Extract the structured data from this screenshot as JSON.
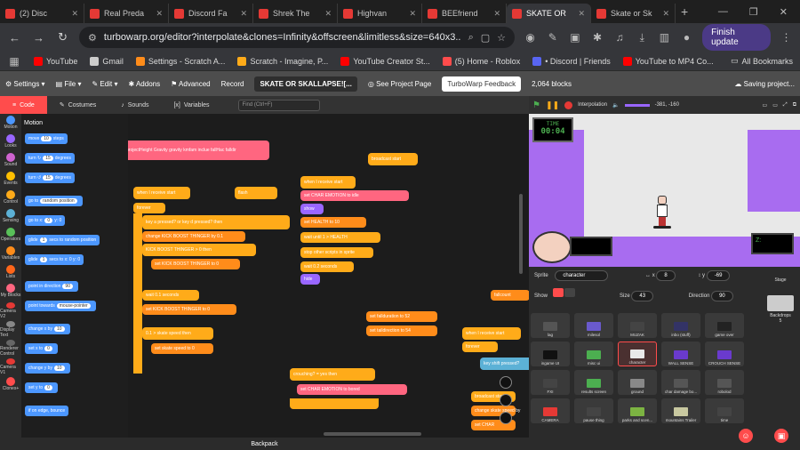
{
  "browser": {
    "tabs": [
      {
        "label": "(2) Disc",
        "active": false
      },
      {
        "label": "Real Preda",
        "active": false
      },
      {
        "label": "Discord Fa",
        "active": false
      },
      {
        "label": "Shrek The",
        "active": false
      },
      {
        "label": "Highvan",
        "active": false
      },
      {
        "label": "BEEfriend",
        "active": false
      },
      {
        "label": "SKATE OR",
        "active": true
      },
      {
        "label": "Skate or Sk",
        "active": false
      }
    ],
    "url": "turbowarp.org/editor?interpolate&clones=Infinity&offscreen&limitless&size=640x3...",
    "finish_update": "Finish update",
    "bookmarks": [
      {
        "label": "YouTube",
        "color": "#ff0000"
      },
      {
        "label": "Gmail",
        "color": "#cccccc"
      },
      {
        "label": "Settings - Scratch A...",
        "color": "#ff8c1a"
      },
      {
        "label": "Scratch - Imagine, P...",
        "color": "#ffab19"
      },
      {
        "label": "YouTube Creator St...",
        "color": "#ff0000"
      },
      {
        "label": "(5) Home - Roblox",
        "color": "#ff4c4c"
      },
      {
        "label": "• Discord | Friends",
        "color": "#5865f2"
      },
      {
        "label": "YouTube to MP4 Co...",
        "color": "#ff0000"
      }
    ],
    "all_bookmarks": "All Bookmarks"
  },
  "menu": {
    "settings": "Settings",
    "file": "File",
    "edit": "Edit",
    "addons": "Addons",
    "advanced": "Advanced",
    "record": "Record",
    "project_title": "SKATE OR SKALLAPSE![...",
    "see_project": "See Project Page",
    "feedback": "TurboWarp Feedback",
    "blocks": "2,064 blocks",
    "saving": "Saving project..."
  },
  "editor_tabs": {
    "code": "Code",
    "costumes": "Costumes",
    "sounds": "Sounds",
    "variables": "Variables",
    "find": "Find (Ctrl+F)"
  },
  "categories": [
    {
      "label": "Motion",
      "color": "#4c97ff"
    },
    {
      "label": "Looks",
      "color": "#9966ff"
    },
    {
      "label": "Sound",
      "color": "#cf63cf"
    },
    {
      "label": "Events",
      "color": "#ffbf00"
    },
    {
      "label": "Control",
      "color": "#ffab19"
    },
    {
      "label": "Sensing",
      "color": "#5cb1d6"
    },
    {
      "label": "Operators",
      "color": "#59c059"
    },
    {
      "label": "Variables",
      "color": "#ff8c1a"
    },
    {
      "label": "Lists",
      "color": "#ff661a"
    },
    {
      "label": "My Blocks",
      "color": "#ff6680"
    },
    {
      "label": "Camera V2",
      "color": "#e53935"
    },
    {
      "label": "Display Text",
      "color": "#888888"
    },
    {
      "label": "Renderer Control",
      "color": "#666666"
    },
    {
      "label": "Camera V1",
      "color": "#e53935"
    },
    {
      "label": "Clones+",
      "color": "#ff4c4c"
    }
  ],
  "palette": {
    "title": "Motion",
    "blocks": [
      {
        "a": "move",
        "v": "10",
        "b": "steps"
      },
      {
        "a": "turn ↻",
        "v": "15",
        "b": "degrees"
      },
      {
        "a": "turn ↺",
        "v": "15",
        "b": "degrees"
      },
      {
        "a": "go to",
        "v": "random position",
        "b": ""
      },
      {
        "a": "go to x:",
        "v": "0",
        "b": "y: 0"
      },
      {
        "a": "glide",
        "v": "1",
        "b": "secs to random position"
      },
      {
        "a": "glide",
        "v": "1",
        "b": "secs to x: 0 y: 0"
      },
      {
        "a": "point in direction",
        "v": "90",
        "b": ""
      },
      {
        "a": "point towards",
        "v": "mouse-pointer",
        "b": ""
      },
      {
        "a": "change x by",
        "v": "10",
        "b": ""
      },
      {
        "a": "set x to",
        "v": "0",
        "b": ""
      },
      {
        "a": "change y by",
        "v": "10",
        "b": ""
      },
      {
        "a": "set y to",
        "v": "0",
        "b": ""
      },
      {
        "a": "if on edge, bounce",
        "v": "",
        "b": ""
      }
    ]
  },
  "workspace": {
    "define_block": "projectHeight  Gravity  gravity  kmfam  inclue  fallHac  falldir",
    "when_receive_a": "when I receive  start",
    "forever": "forever",
    "key": "key  a  pressed?  or  key  d  pressed?  then",
    "change_kick": "change  KICK BOOST THINGER  by  0.1",
    "kick_then": "KICK BOOST THINGER  >  0  then",
    "set_kick": "set  KICK BOOST THINGER  to  0",
    "wait": "wait  0.1  seconds",
    "set_kick2": "set  KICK BOOST THINGER  to  0",
    "skate_speed": "0.1  >  skate speed  then",
    "set_speed": "set  skate speed  to  0",
    "flash": "flash",
    "when_receive_b": "when I receive  start",
    "set_emotion": "set  CHAR EMOTION  to  idle",
    "show": "show",
    "set_health": "set  HEALTH  to  10",
    "wait_until": "wait until  1  >  HEALTH",
    "stop": "stop  other scripts in sprite",
    "wait2": "wait  0.2  seconds",
    "hide": "hide",
    "broadcast": "broadcast  start",
    "fallduration": "set  fallduration  to  52",
    "taildirection": "set  taildirection  to  54",
    "crouching": "crouching?  =  yes  then",
    "set_emotion2": "set  CHAR EMOTION  to  bored",
    "when_receive_c": "when I receive  start",
    "forever2": "forever",
    "key_shift": "key  shift  pressed?",
    "broadcast2": "broadcast  start",
    "change_speed": "change  skate speed  by",
    "set_char": "set  CHAR",
    "fallcounter": "fallcount"
  },
  "backpack": "Backpack",
  "stage_bar": {
    "interpolation": "Interpolation",
    "coords": "-381, -160"
  },
  "stage": {
    "timer_label": "TIME",
    "timer_value": "00:04",
    "z_label": "Z:"
  },
  "sprite_info": {
    "sprite_label": "Sprite",
    "sprite_name": "character",
    "x_label": "↔ x",
    "x": "8",
    "y_label": "↕ y",
    "y": "-69",
    "show_label": "Show",
    "size_label": "Size",
    "size": "43",
    "direction_label": "Direction",
    "direction": "90"
  },
  "sprites": [
    {
      "label": "lag",
      "color": "#555555"
    },
    {
      "label": "milesol",
      "color": "#6a5acd"
    },
    {
      "label": "MUZAK",
      "color": "#444444"
    },
    {
      "label": "inbo (stuff)",
      "color": "#333366"
    },
    {
      "label": "game over",
      "color": "#222222"
    },
    {
      "label": "ingame UI",
      "color": "#111111"
    },
    {
      "label": "misc ui",
      "color": "#4caf50"
    },
    {
      "label": "character",
      "color": "#e8e8e8",
      "selected": true
    },
    {
      "label": "WALL SENSE",
      "color": "#6a3acd"
    },
    {
      "label": "CROUCH SENSE",
      "color": "#6a3acd"
    },
    {
      "label": "FXI",
      "color": "#444444"
    },
    {
      "label": "results screen",
      "color": "#4caf50"
    },
    {
      "label": "ground",
      "color": "#888888"
    },
    {
      "label": "char damage bo...",
      "color": "#555555"
    },
    {
      "label": "robolod",
      "color": "#555555"
    },
    {
      "label": "CAMERA",
      "color": "#e53935"
    },
    {
      "label": "pause thing",
      "color": "#444444"
    },
    {
      "label": "parks and scen...",
      "color": "#7cb342"
    },
    {
      "label": "mountains Trailer",
      "color": "#c8c8a0"
    },
    {
      "label": "time",
      "color": "#444444"
    }
  ],
  "stage_panel": {
    "label": "Stage",
    "backdrops_label": "Backdrops",
    "backdrops": "5"
  }
}
